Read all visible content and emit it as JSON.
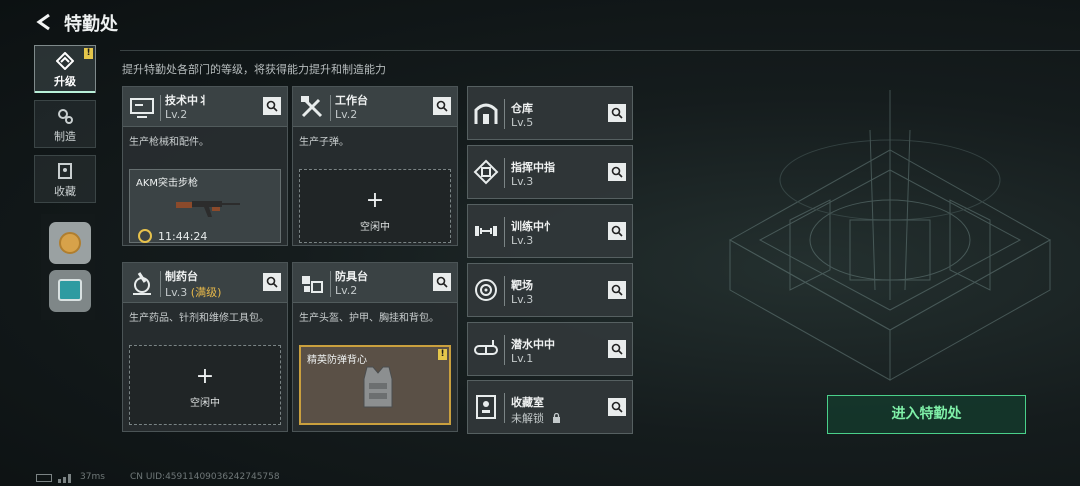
{
  "header": {
    "title": "特勤处",
    "subtitle": "提升特勤处各部门的等级，将获得能力提升和制造能力"
  },
  "nav": {
    "items": [
      {
        "label": "升级",
        "icon": "upgrade-icon",
        "active": true,
        "badge": "!"
      },
      {
        "label": "制造",
        "icon": "gears-icon",
        "active": false
      },
      {
        "label": "收藏",
        "icon": "collection-icon",
        "active": false
      }
    ]
  },
  "facilities": {
    "tech": {
      "name": "技术中⺦",
      "level": "Lv.2",
      "desc": "生产枪械和配件。",
      "slot_title": "AKM突击步枪",
      "slot_time": "11:44:24",
      "icon": "monitor-icon"
    },
    "workbench": {
      "name": "工作台",
      "level": "Lv.2",
      "desc": "生产子弹。",
      "slot_plus": "+",
      "slot_label": "空闲中",
      "icon": "tools-icon"
    },
    "pharmacy": {
      "name": "制药台",
      "level": "Lv.3",
      "level_suffix": "(满级)",
      "desc": "生产药品、针剂和维修工具包。",
      "slot_plus": "+",
      "slot_label": "空闲中",
      "icon": "microscope-icon"
    },
    "armor": {
      "name": "防具台",
      "level": "Lv.2",
      "desc": "生产头盔、护甲、胸挂和背包。",
      "slot_title": "精英防弹背心",
      "slot_badge": "!",
      "icon": "armor-icon"
    }
  },
  "mini_facilities": [
    {
      "name": "仓库",
      "level": "Lv.5",
      "icon": "warehouse-icon"
    },
    {
      "name": "指挥中指",
      "level": "Lv.3",
      "icon": "command-icon"
    },
    {
      "name": "训练中忄",
      "level": "Lv.3",
      "icon": "dumbbell-icon"
    },
    {
      "name": "靶场",
      "level": "Lv.3",
      "icon": "target-icon"
    },
    {
      "name": "潜水中中",
      "level": "Lv.1",
      "icon": "goggles-icon"
    },
    {
      "name": "收藏室",
      "level": "未解锁",
      "icon": "collection-room-icon",
      "locked": true
    }
  ],
  "enter_button": "进入特勤处",
  "footer": {
    "ping": "37ms",
    "uid": "CN UID:4591140903624274575​8"
  },
  "colors": {
    "accent_green": "#4ad08a",
    "badge_yellow": "#e4c64b",
    "maxed_gold": "#e8b94a"
  }
}
